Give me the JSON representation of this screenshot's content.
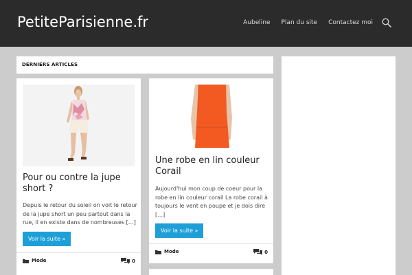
{
  "header": {
    "site_title": "PetiteParisienne.fr",
    "nav": [
      "Aubeline",
      "Plan du site",
      "Contactez moi"
    ],
    "search_icon": "search-icon"
  },
  "widget": {
    "title": "DERNIERS ARTICLES"
  },
  "posts": [
    {
      "title": "Pour ou contre la jupe short ?",
      "excerpt": "Depuis le retour du soleil on voit le retour de la jupe short un peu partout dans la rue, Il en existe dans de nombreuses […]",
      "read_more": "Voir la suite »",
      "category": "Mode",
      "comments": "0",
      "category_icon": "folder-icon",
      "comments_icon": "comments-icon"
    },
    {
      "title": "Une robe en lin couleur Corail",
      "excerpt": "Aujourd'hui mon coup de coeur pour la robe en lin couleur corail La robe corail à toujours le vent en poupe et je dois dire […]",
      "read_more": "Voir la suite »",
      "category": "Mode",
      "comments": "0",
      "category_icon": "folder-icon",
      "comments_icon": "comments-icon"
    }
  ],
  "colors": {
    "header_bg": "#2b2b2b",
    "page_bg": "#cccccc",
    "accent": "#1e9fd8",
    "dress": "#f25a22"
  }
}
